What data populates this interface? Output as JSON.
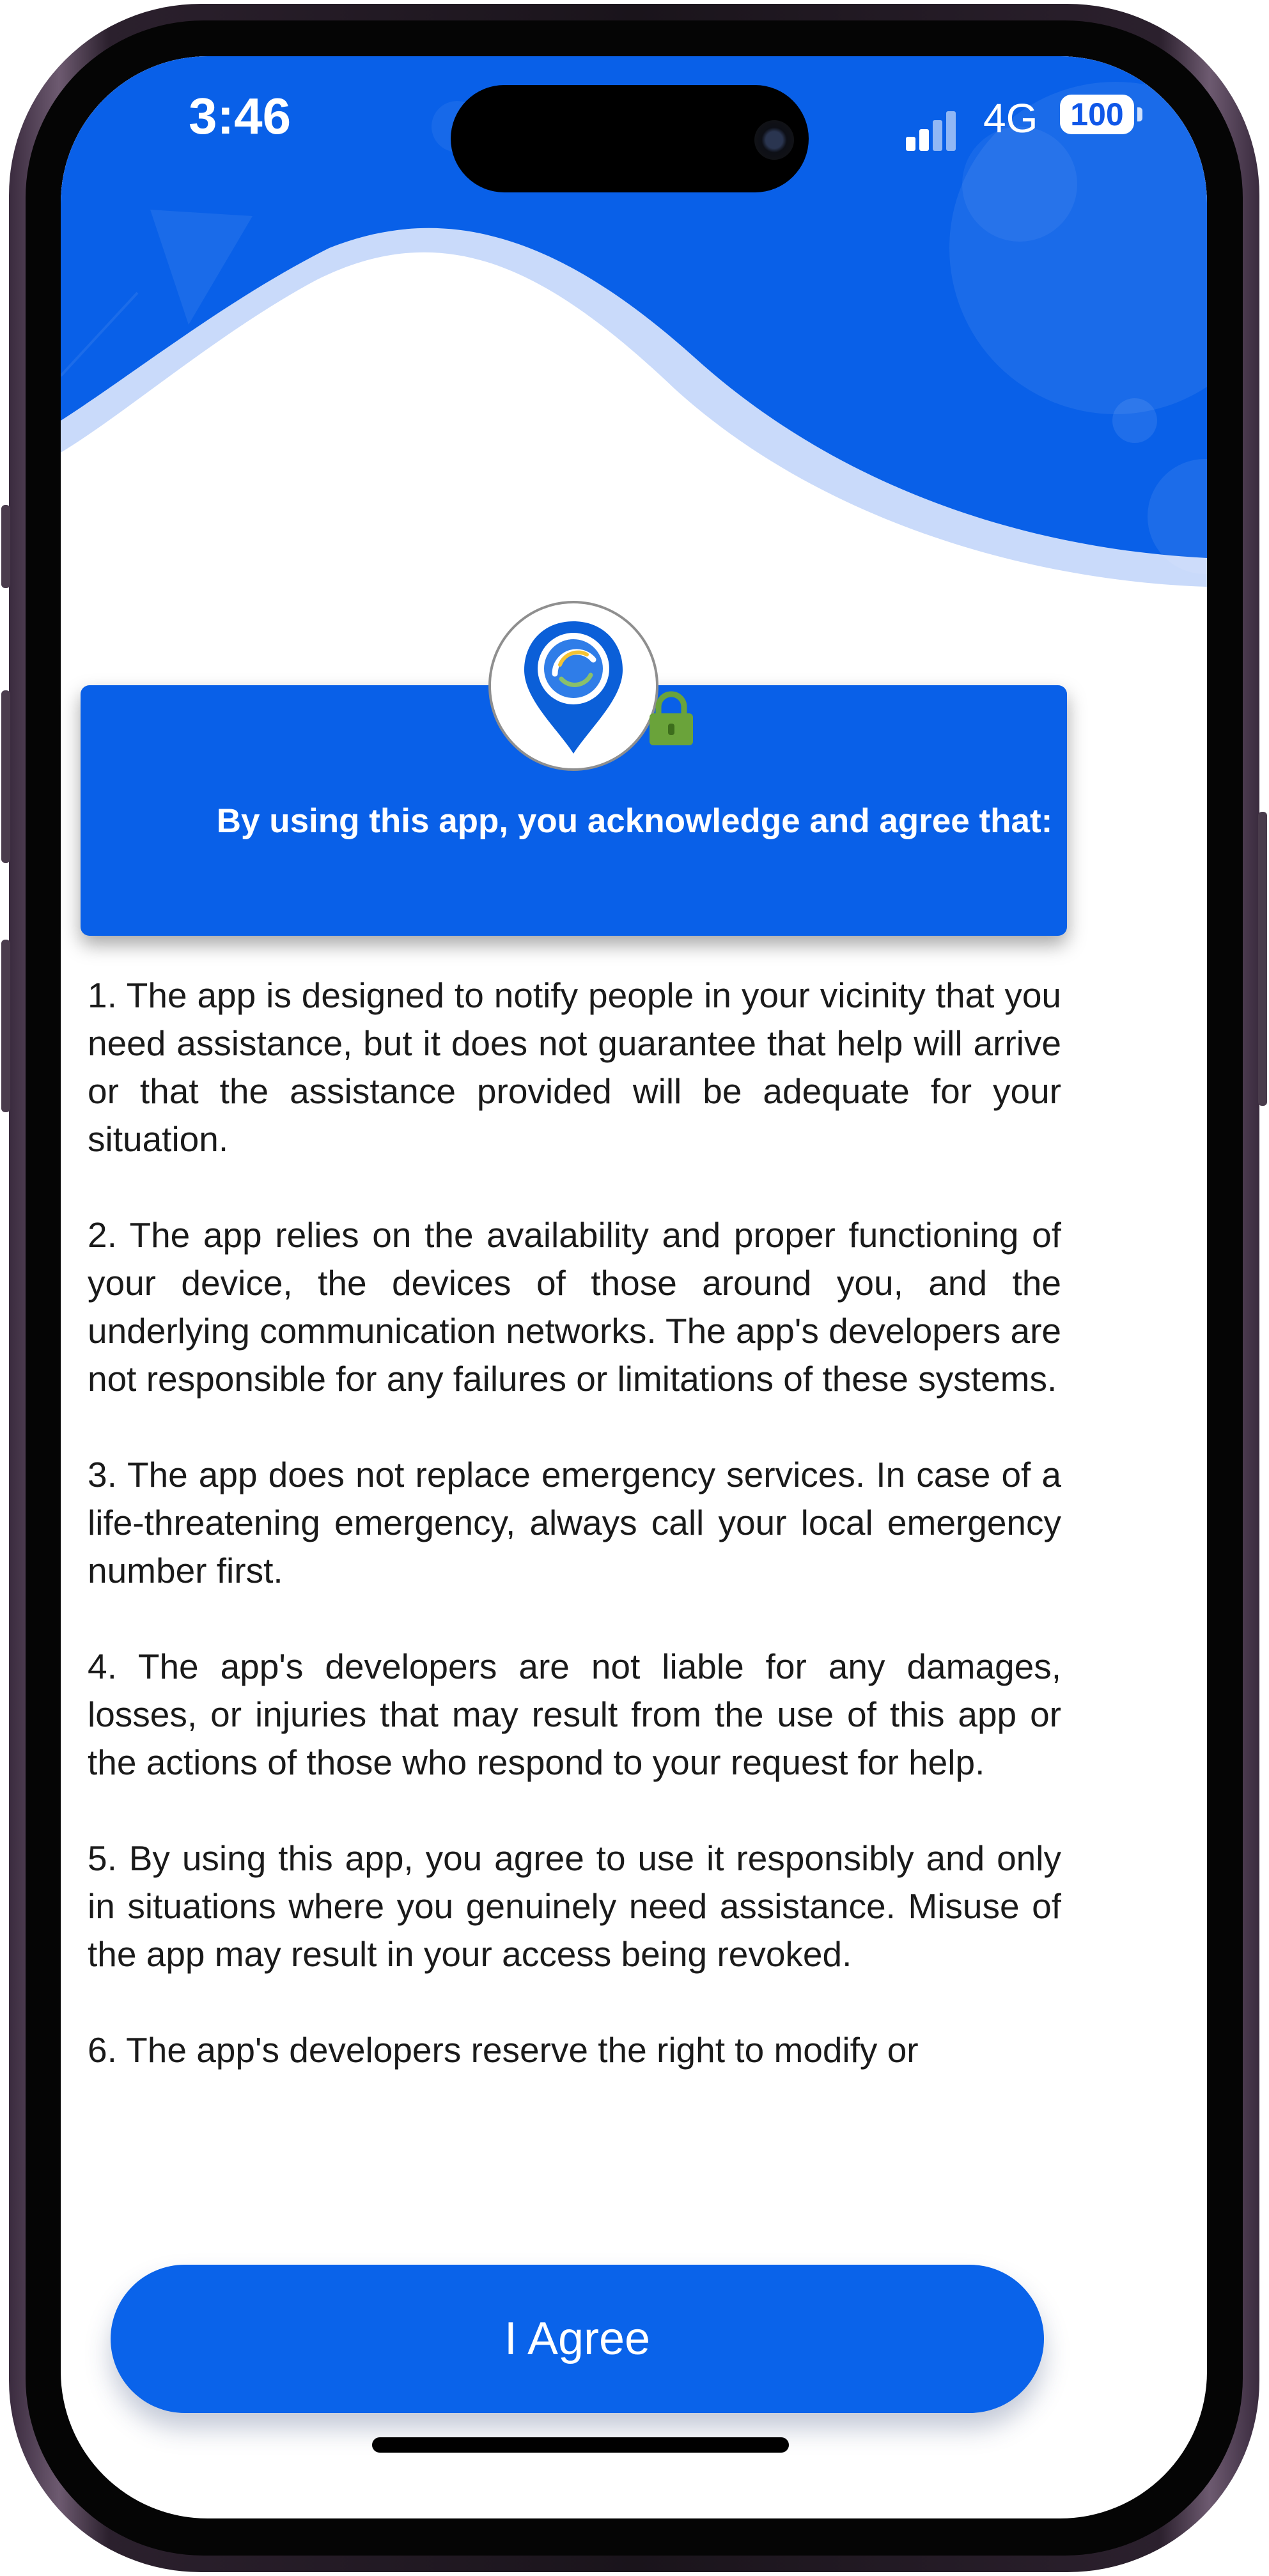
{
  "status_bar": {
    "time": "3:46",
    "network": "4G",
    "battery": "100"
  },
  "card": {
    "title": "By using this app, you acknowledge and agree that:"
  },
  "terms": [
    "1. The app is designed to notify people in your vicinity that you need assistance, but it does not guarantee that help will arrive or that the assistance provided will be adequate for your situation.",
    "2. The app relies on the availability and proper functioning of your device, the devices of those around you, and the underlying communication networks. The app's developers are not responsible for any failures or limitations of these systems.",
    "3. The app does not replace emergency services. In case of a life-threatening emergency, always call your local emergency number first.",
    "4. The app's developers are not liable for any damages, losses, or injuries that may result from the use of this app or the actions of those who respond to your request for help.",
    "5. By using this app, you agree to use it responsibly and only in situations where you genuinely need assistance. Misuse of the app may result in your access being revoked.",
    "6. The app's developers reserve the right to modify or"
  ],
  "actions": {
    "agree_label": "I Agree"
  },
  "colors": {
    "primary": "#0960e8",
    "wave_light": "#c9dafa",
    "lock": "#6aa33a"
  }
}
